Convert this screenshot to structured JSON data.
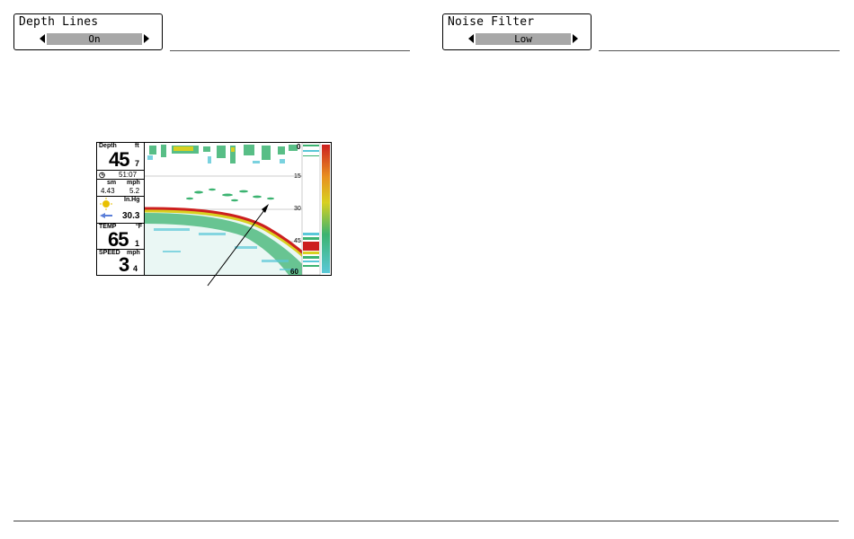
{
  "menus": [
    {
      "title": "Depth Lines",
      "value": "On"
    },
    {
      "title": "Noise Filter",
      "value": "Low"
    }
  ],
  "sonar": {
    "depth_label": "Depth",
    "depth_unit": "ft",
    "depth_value": "45",
    "depth_decimal": "7",
    "timer": "51:07",
    "dist_unit": "sm",
    "speed_unit1": "mph",
    "distance": "4.43",
    "speed1": "5.2",
    "pressure_unit": "In.Hg",
    "pressure": "30.3",
    "temp_label": "TEMP",
    "temp_unit": "°F",
    "temp_value": "65",
    "temp_decimal": "1",
    "speed_label": "SPEED",
    "speed_unit2": "mph",
    "speed_value": "3",
    "speed_decimal": "4",
    "depth_scale": [
      "0",
      "15",
      "30",
      "45",
      "60"
    ]
  },
  "colors": {
    "bottom_red": "#cc1f1f",
    "sonar_green": "#3cb371",
    "sonar_yellow": "#d8d020",
    "sonar_cyan": "#5ac8d8"
  }
}
